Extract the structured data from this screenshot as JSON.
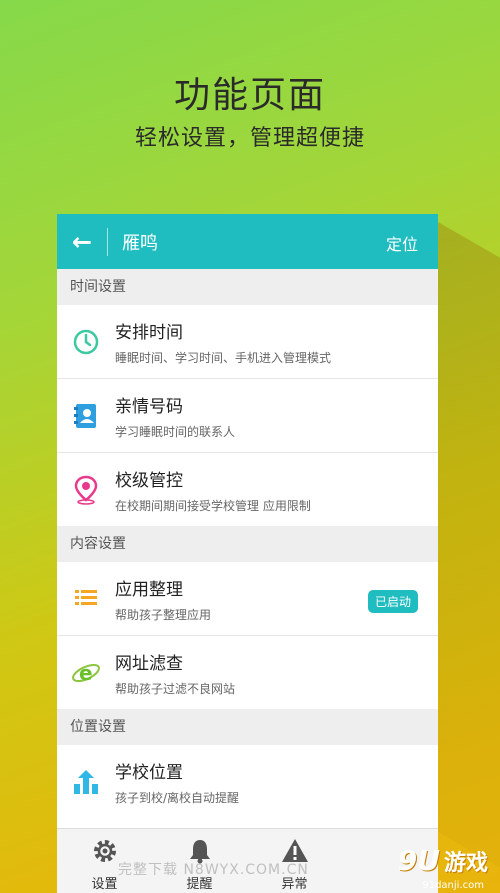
{
  "promo": {
    "title": "功能页面",
    "subtitle": "轻松设置，管理超便捷"
  },
  "appbar": {
    "back_icon": "arrow-left-icon",
    "title": "雁鸣",
    "action": "定位"
  },
  "sections": [
    {
      "header": "时间设置",
      "items": [
        {
          "icon": "clock-icon",
          "title": "安排时间",
          "desc": "睡眠时间、学习时间、手机进入管理模式"
        },
        {
          "icon": "contacts-icon",
          "title": "亲情号码",
          "desc": "学习睡眠时间的联系人"
        },
        {
          "icon": "location-pin-icon",
          "title": "校级管控",
          "desc": "在校期间期间接受学校管理 应用限制"
        }
      ]
    },
    {
      "header": "内容设置",
      "items": [
        {
          "icon": "list-icon",
          "title": "应用整理",
          "desc": "帮助孩子整理应用",
          "badge": "已启动"
        },
        {
          "icon": "ie-browser-icon",
          "title": "网址滤查",
          "desc": "帮助孩子过滤不良网站"
        }
      ]
    },
    {
      "header": "位置设置",
      "items": [
        {
          "icon": "school-icon",
          "title": "学校位置",
          "desc": "孩子到校/离校自动提醒"
        }
      ]
    }
  ],
  "bottom_nav": [
    {
      "icon": "gear-icon",
      "label": "设置"
    },
    {
      "icon": "bell-icon",
      "label": "提醒"
    },
    {
      "icon": "warning-icon",
      "label": "异常"
    }
  ],
  "watermark": {
    "text": "完整下载 N8WYX.COM.CN",
    "logo_num": "9U",
    "logo_text": "游戏",
    "logo_url": "91danji.com"
  },
  "colors": {
    "accent": "#1fbcc0",
    "background_top": "#86d94a",
    "background_bottom": "#e9b40c"
  }
}
